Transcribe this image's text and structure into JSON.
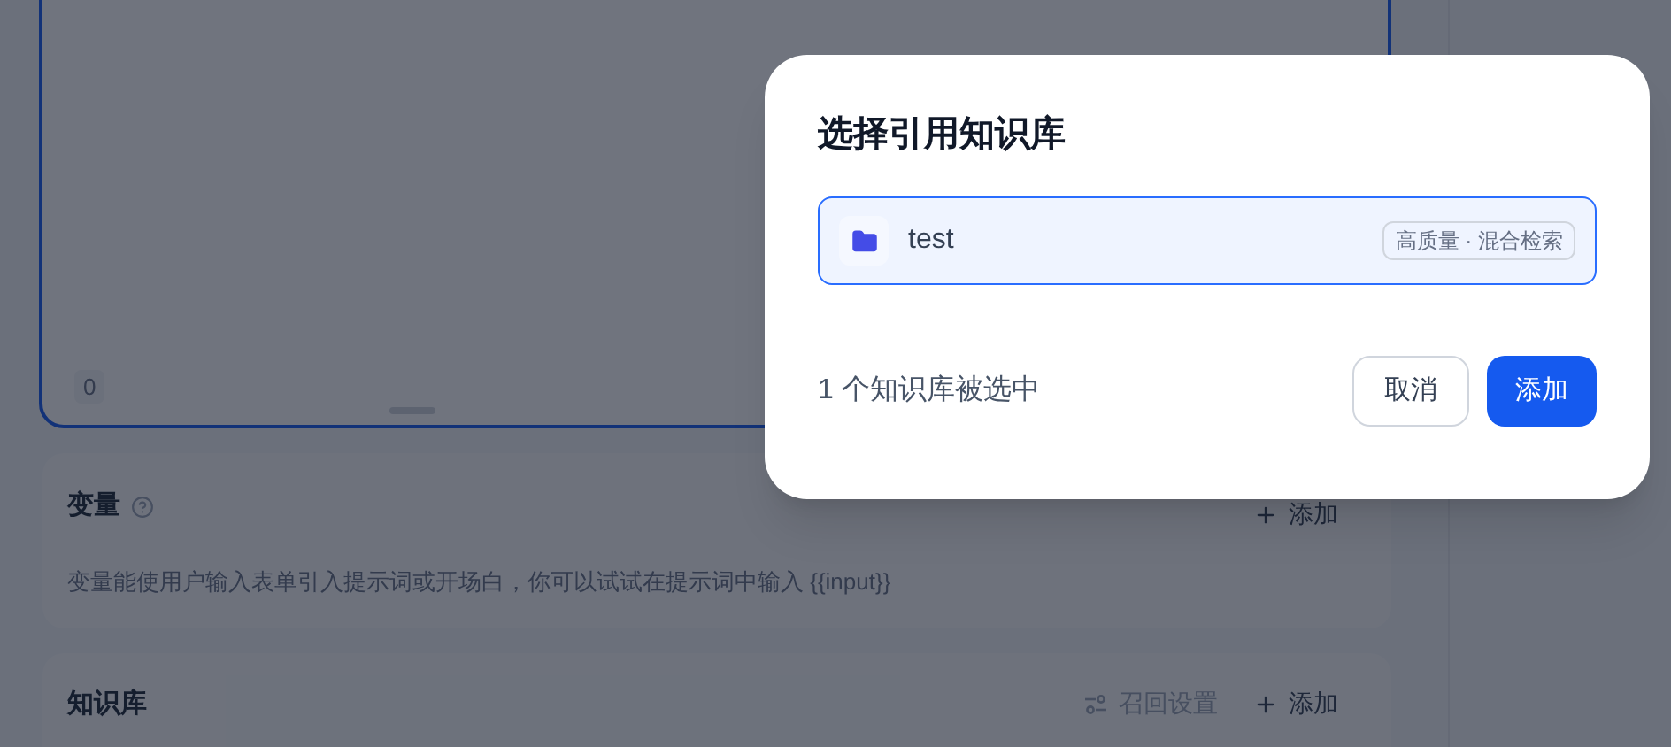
{
  "editor": {
    "char_count": "0"
  },
  "variables": {
    "title": "变量",
    "add_label": "添加",
    "description": "变量能使用户输入表单引入提示词或开场白，你可以试试在提示词中输入 {{input}}"
  },
  "knowledge": {
    "title": "知识库",
    "recall_label": "召回设置",
    "add_label": "添加"
  },
  "dialog": {
    "title": "选择引用知识库",
    "datasets": [
      {
        "name": "test",
        "badge": "高质量 · 混合检索",
        "selected": true
      }
    ],
    "selected_count": "1 个知识库被选中",
    "buttons": [
      {
        "label": "取消",
        "kind": "secondary"
      },
      {
        "label": "添加",
        "kind": "primary"
      }
    ]
  }
}
